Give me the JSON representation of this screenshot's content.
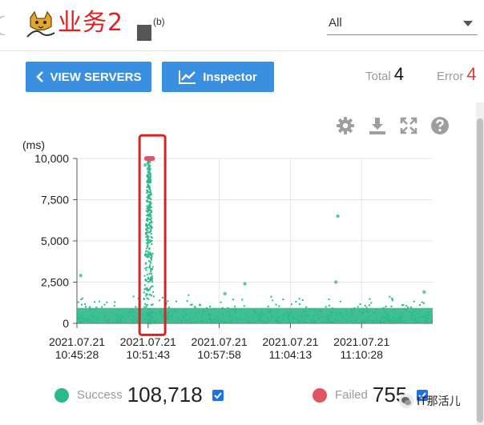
{
  "header": {
    "app_title": "业务2",
    "agent_status": "(b)",
    "agent_select_value": "All"
  },
  "toolbar": {
    "view_servers_label": "VIEW SERVERS",
    "inspector_label": "Inspector"
  },
  "stats": {
    "total_label": "Total",
    "total_value": "4",
    "error_label": "Error",
    "error_value": "4"
  },
  "chart_tools": [
    "gear-icon",
    "download-icon",
    "fullscreen-icon",
    "help-icon"
  ],
  "legend": {
    "success_label": "Success",
    "success_value": "108,718",
    "success_checked": true,
    "failed_label": "Failed",
    "failed_value": "755",
    "failed_checked": true
  },
  "colors": {
    "accent": "#3b8fe0",
    "success": "#2bb88a",
    "failed": "#e05561",
    "error_value": "#e43a3a",
    "title": "#e02020",
    "highlight_box": "#e02020"
  },
  "watermark": "IT那活儿",
  "chart_data": {
    "type": "scatter",
    "title": "",
    "xlabel": "",
    "ylabel": "(ms)",
    "ylim": [
      0,
      10000
    ],
    "y_ticks": [
      0,
      2500,
      5000,
      7500,
      10000
    ],
    "y_tick_labels": [
      "0",
      "2,500",
      "5,000",
      "7,500",
      "10,000"
    ],
    "x_range": [
      "2021.07.21 10:45:28",
      "2021.07.21 11:16:43"
    ],
    "x_ticks": [
      "10:45:28",
      "10:51:43",
      "10:57:58",
      "11:04:13",
      "11:10:28"
    ],
    "x_tick_labels": [
      [
        "2021.07.21",
        "10:45:28"
      ],
      [
        "2021.07.21",
        "10:51:43"
      ],
      [
        "2021.07.21",
        "10:57:58"
      ],
      [
        "2021.07.21",
        "11:04:13"
      ],
      [
        "2021.07.21",
        "11:10:28"
      ]
    ],
    "grid": true,
    "series": [
      {
        "name": "Success",
        "color": "#2bb88a",
        "band": {
          "x_from": "10:45:28",
          "x_to": "11:16:43",
          "y_low": 0,
          "y_high": 1700
        },
        "spike": {
          "x_from": "10:51:13",
          "x_to": "10:52:13",
          "y_low": 0,
          "y_high": 10000
        },
        "outliers": [
          {
            "x": "10:45:48",
            "y": 2900
          },
          {
            "x": "10:51:28",
            "y": 9600
          },
          {
            "x": "10:58:28",
            "y": 1800
          },
          {
            "x": "11:00:13",
            "y": 2400
          },
          {
            "x": "11:08:13",
            "y": 2500
          },
          {
            "x": "11:08:23",
            "y": 6500
          },
          {
            "x": "11:15:58",
            "y": 1900
          }
        ]
      },
      {
        "name": "Failed",
        "color": "#e05561",
        "points": [
          {
            "x": "10:51:35",
            "y": 10000
          },
          {
            "x": "10:51:43",
            "y": 10000
          },
          {
            "x": "10:51:51",
            "y": 10000
          },
          {
            "x": "10:51:59",
            "y": 10000
          },
          {
            "x": "10:52:07",
            "y": 10000
          }
        ]
      }
    ],
    "annotations": [
      {
        "type": "highlight-rect",
        "x_from": "10:50:58",
        "x_to": "10:53:13",
        "y_from": -700,
        "y_to": 11400,
        "color": "#e02020"
      }
    ]
  }
}
